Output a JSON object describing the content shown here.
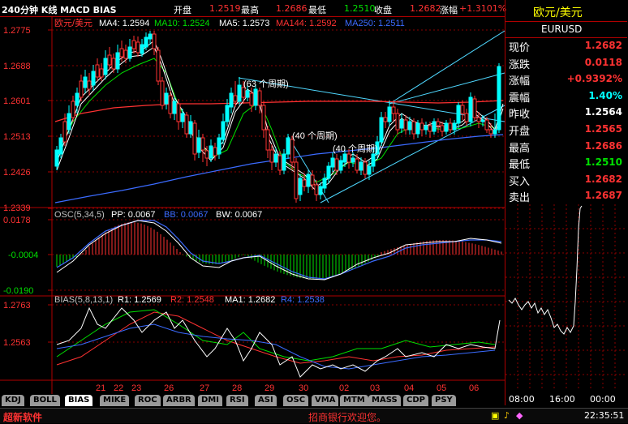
{
  "topbar": {
    "title": "240分钟 K线 MACD BIAS",
    "open_label": "开盘",
    "open_value": "1.2519",
    "high_label": "最高",
    "high_value": "1.2686",
    "low_label": "最低",
    "low_value": "1.2510",
    "close_label": "收盘",
    "close_value": "1.2682",
    "change_label": "涨幅",
    "change_value": "+1.3101%"
  },
  "main_panel": {
    "symbol": "欧元/美元",
    "ma_legend": [
      {
        "text": "MA4: 1.2594",
        "color": "#ffffff"
      },
      {
        "text": "MA10: 1.2524",
        "color": "#00e000"
      },
      {
        "text": "MA5: 1.2573",
        "color": "#ffffff"
      },
      {
        "text": "MA144: 1.2592",
        "color": "#ff3232"
      },
      {
        "text": "MA250: 1.2511",
        "color": "#3b6bff"
      }
    ],
    "y_ticks": [
      "1.2775",
      "1.2688",
      "1.2601",
      "1.2513",
      "1.2426",
      "1.2339"
    ],
    "annotations": [
      "(63 个周期)",
      "(40 个周期)",
      "(40 个周期)"
    ]
  },
  "osc_panel": {
    "legend": [
      {
        "text": "OSC(5,34,5)",
        "color": "#c0c0c0"
      },
      {
        "text": "PP: 0.0067",
        "color": "#ffffff"
      },
      {
        "text": "BB: 0.0067",
        "color": "#3b6bff"
      },
      {
        "text": "BW: 0.0067",
        "color": "#ffffff"
      }
    ],
    "y_ticks": [
      "0.0178",
      "-0.0004",
      "-0.0190"
    ]
  },
  "bias_panel": {
    "legend": [
      {
        "text": "BIAS(5,8,13,1)",
        "color": "#c0c0c0"
      },
      {
        "text": "R1: 1.2569",
        "color": "#ffffff"
      },
      {
        "text": "R2: 1.2548",
        "color": "#ff3232"
      },
      {
        "text": "MA1: 1.2682",
        "color": "#ffffff"
      },
      {
        "text": "R4: 1.2538",
        "color": "#3b6bff"
      }
    ],
    "y_ticks": [
      "1.2763",
      "1.2563"
    ]
  },
  "x_axis": [
    "21",
    "22",
    "23",
    "26",
    "27",
    "28",
    "29",
    "30",
    "02",
    "03",
    "04",
    "05",
    "06"
  ],
  "quote": {
    "name": "欧元/美元",
    "code": "EURUSD",
    "rows": [
      {
        "label": "现价",
        "value": "1.2682",
        "color": "#ff3232"
      },
      {
        "label": "涨跌",
        "value": "0.0118",
        "color": "#ff3232"
      },
      {
        "label": "涨幅",
        "value": "+0.9392%",
        "color": "#ff3232"
      },
      {
        "label": "震幅",
        "value": "1.40%",
        "color": "#00ffff"
      },
      {
        "label": "昨收",
        "value": "1.2564",
        "color": "#ffffff"
      },
      {
        "label": "开盘",
        "value": "1.2565",
        "color": "#ff3232"
      },
      {
        "label": "最高",
        "value": "1.2686",
        "color": "#ff3232"
      },
      {
        "label": "最低",
        "value": "1.2510",
        "color": "#00e000"
      },
      {
        "label": "买入",
        "value": "1.2682",
        "color": "#ff3232"
      },
      {
        "label": "卖出",
        "value": "1.2687",
        "color": "#ff3232"
      }
    ],
    "time_axis": [
      "08:00",
      "16:00",
      "00:00"
    ]
  },
  "tabs": [
    "KDJ",
    "BOLL",
    "BIAS",
    "MIKE",
    "ROC",
    "ARBR",
    "DMI",
    "RSI",
    "ASI",
    "OSC",
    "VMA",
    "MTM",
    "MASS",
    "CDP",
    "PSY"
  ],
  "active_tab": "BIAS",
  "status": {
    "app_name": "超新软件",
    "welcome": "招商银行欢迎您。",
    "clock": "22:35:51"
  }
}
